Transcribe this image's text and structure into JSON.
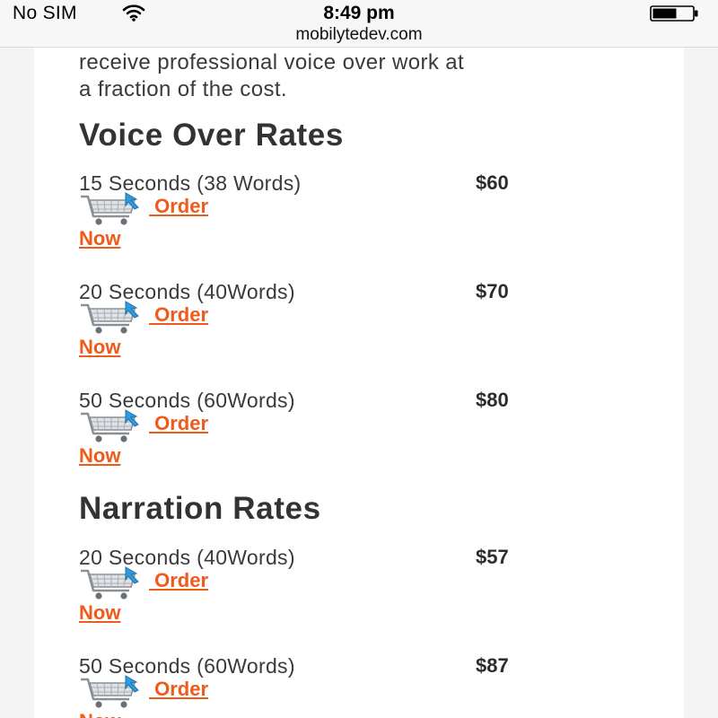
{
  "status_bar": {
    "carrier": "No SIM",
    "time": "8:49 pm"
  },
  "browser": {
    "url": "mobilytedev.com"
  },
  "intro": {
    "line1": "receive professional voice over work at",
    "line2": "a fraction of the cost."
  },
  "voice_over": {
    "title": "Voice Over Rates",
    "items": [
      {
        "description": "15 Seconds (38 Words)",
        "price": "$60",
        "order_label": " Order",
        "now_label": "Now"
      },
      {
        "description": "20 Seconds (40Words)",
        "price": "$70",
        "order_label": " Order",
        "now_label": "Now"
      },
      {
        "description": "50 Seconds (60Words)",
        "price": "$80",
        "order_label": " Order",
        "now_label": "Now"
      }
    ]
  },
  "narration": {
    "title": "Narration Rates",
    "items": [
      {
        "description": "20 Seconds (40Words)",
        "price": "$57",
        "order_label": " Order",
        "now_label": "Now"
      },
      {
        "description": "50 Seconds (60Words)",
        "price": "$87",
        "order_label": " Order",
        "now_label": "Now"
      }
    ]
  },
  "colors": {
    "link": "#f05a1a",
    "text": "#3a3a3a",
    "heading": "#333333"
  },
  "icons": {
    "cart": "shopping-cart-icon",
    "wifi": "wifi-icon",
    "battery": "battery-icon"
  }
}
